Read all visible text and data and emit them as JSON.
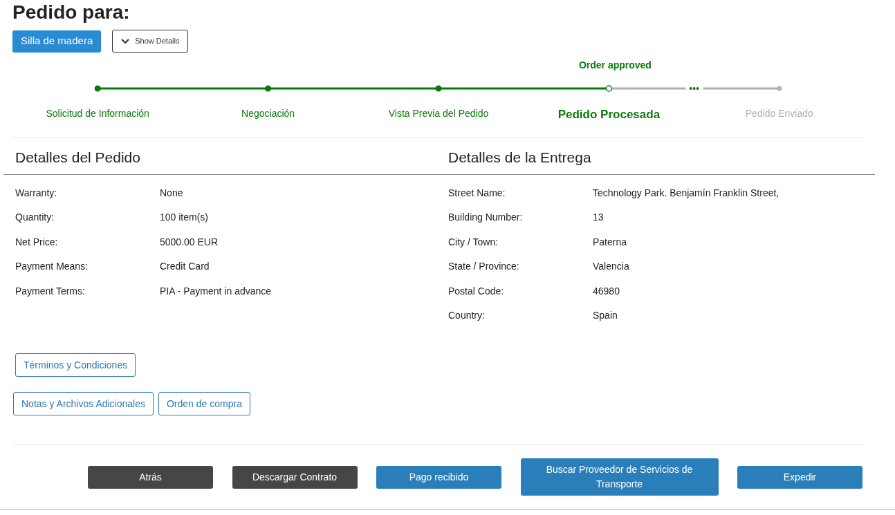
{
  "title": "Pedido para:",
  "product_button": "Silla de madera",
  "details_toggle": {
    "label": "Show Details",
    "expanded": false
  },
  "progress": {
    "status_label": "Order approved",
    "steps": [
      {
        "label": "Solicitud de Información",
        "kind": "done"
      },
      {
        "label": "Negociación",
        "kind": "done"
      },
      {
        "label": "Vista Previa del Pedido",
        "kind": "done"
      },
      {
        "label": "Pedido Procesada",
        "kind": "current"
      },
      {
        "label": "Pedido Enviado",
        "kind": "pending"
      }
    ]
  },
  "order_details": {
    "heading": "Detalles del Pedido",
    "fields": [
      {
        "label": "Warranty:",
        "value": "None"
      },
      {
        "label": "Quantity:",
        "value": "100 item(s)"
      },
      {
        "label": "Net Price:",
        "value": "5000.00 EUR"
      },
      {
        "label": "Payment Means:",
        "value": "Credit Card"
      },
      {
        "label": "Payment Terms:",
        "value": "PIA - Payment in advance"
      }
    ]
  },
  "delivery_details": {
    "heading": "Detalles de la Entrega",
    "fields": [
      {
        "label": "Street Name:",
        "value": "Technology Park. Benjamín Franklin Street,"
      },
      {
        "label": "Building Number:",
        "value": "13"
      },
      {
        "label": "City / Town:",
        "value": "Paterna"
      },
      {
        "label": "State / Province:",
        "value": "Valencia"
      },
      {
        "label": "Postal Code:",
        "value": "46980"
      },
      {
        "label": "Country:",
        "value": "Spain"
      }
    ]
  },
  "document_buttons": [
    [
      "Términos y Condiciones"
    ],
    [
      "Notas y Archivos Adicionales",
      "Orden de compra"
    ]
  ],
  "actions": [
    {
      "label": "Atrás",
      "kind": "dark"
    },
    {
      "label": "Descargar Contrato",
      "kind": "dark"
    },
    {
      "label": "Pago recibido",
      "kind": "primary"
    },
    {
      "label": "Buscar Proveedor de Servicios de Transporte",
      "kind": "primary"
    },
    {
      "label": "Expedir",
      "kind": "primary"
    }
  ]
}
